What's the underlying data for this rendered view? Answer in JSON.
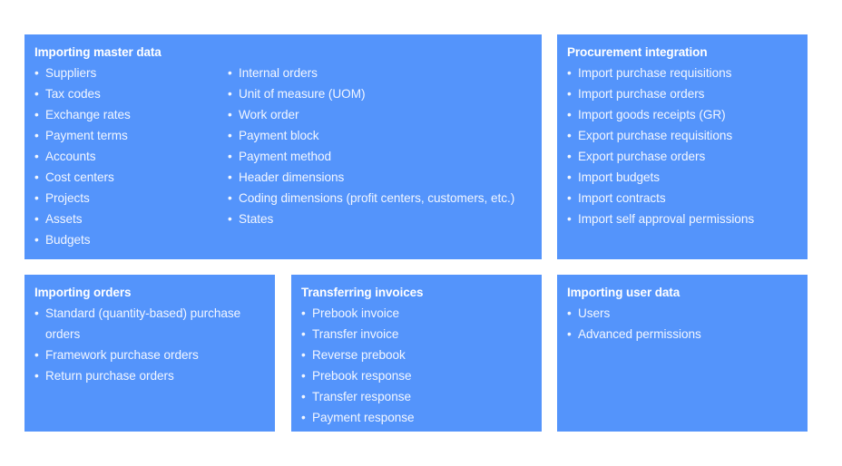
{
  "theme": {
    "panel_color": "#5494fb",
    "title_color": "#ffffff",
    "text_color": "#f2f6ff",
    "background_color": "#ffffff",
    "bullet_glyph": "•"
  },
  "panels": {
    "master_data": {
      "title": "Importing master data",
      "column_left": [
        "Suppliers",
        "Tax codes",
        "Exchange rates",
        "Payment terms",
        "Accounts",
        "Cost centers",
        "Projects",
        "Assets",
        "Budgets"
      ],
      "column_right": [
        "Internal orders",
        "Unit of measure (UOM)",
        "Work order",
        "Payment block",
        "Payment method",
        "Header dimensions",
        "Coding dimensions (profit centers, customers, etc.)",
        "States"
      ]
    },
    "procurement": {
      "title": "Procurement integration",
      "items": [
        "Import purchase requisitions",
        "Import purchase orders",
        "Import goods receipts (GR)",
        "Export purchase requisitions",
        "Export purchase orders",
        "Import budgets",
        "Import contracts",
        "Import self approval permissions"
      ]
    },
    "orders": {
      "title": "Importing orders",
      "items": [
        "Standard (quantity-based) purchase orders",
        "Framework purchase orders",
        "Return purchase orders"
      ]
    },
    "invoices": {
      "title": "Transferring invoices",
      "items": [
        "Prebook invoice",
        "Transfer invoice",
        "Reverse prebook",
        "Prebook response",
        "Transfer response",
        "Payment response"
      ]
    },
    "user_data": {
      "title": "Importing user data",
      "items": [
        "Users",
        "Advanced permissions"
      ]
    }
  }
}
